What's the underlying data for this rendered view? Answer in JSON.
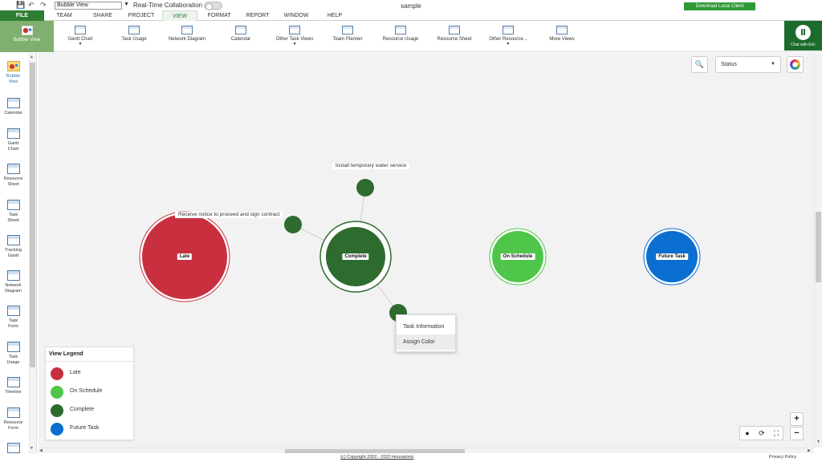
{
  "app": {
    "doc_title": "sample",
    "view_select": "Bubble View",
    "rtc_label": "Real-Time Collaboration",
    "download_label": "Download Local Client",
    "chat_label": "Chat with Eric"
  },
  "menu": [
    "TEAM",
    "SHARE",
    "PROJECT",
    "VIEW",
    "FORMAT",
    "REPORT",
    "WINDOW",
    "HELP"
  ],
  "file_tab": "FILE",
  "active_menu": "VIEW",
  "ribbon": [
    {
      "label": "Bubble View",
      "icon": "bubble-view-icon",
      "dropdown": false,
      "active": true
    },
    {
      "label": "Gantt Chart",
      "icon": "gantt-chart-icon",
      "dropdown": true
    },
    {
      "label": "Task Usage",
      "icon": "task-usage-icon",
      "dropdown": false
    },
    {
      "label": "Network Diagram",
      "icon": "network-diagram-icon",
      "dropdown": false
    },
    {
      "label": "Calendar",
      "icon": "calendar-icon",
      "dropdown": false
    },
    {
      "label": "Other Task Views",
      "icon": "other-task-views-icon",
      "dropdown": true
    },
    {
      "label": "Team Planner",
      "icon": "team-planner-icon",
      "dropdown": false
    },
    {
      "label": "Resource Usage",
      "icon": "resource-usage-icon",
      "dropdown": false
    },
    {
      "label": "Resource Sheet",
      "icon": "resource-sheet-icon",
      "dropdown": false
    },
    {
      "label": "Other Resource...",
      "icon": "other-resource-icon",
      "dropdown": true
    },
    {
      "label": "More Views",
      "icon": "more-views-icon",
      "dropdown": false
    }
  ],
  "sidebar": [
    {
      "line1": "Bubble",
      "line2": "View",
      "active": true
    },
    {
      "line1": "Calendar",
      "line2": ""
    },
    {
      "line1": "Gantt",
      "line2": "Chart"
    },
    {
      "line1": "Resource",
      "line2": "Sheet"
    },
    {
      "line1": "Task",
      "line2": "Sheet"
    },
    {
      "line1": "Tracking",
      "line2": "Gantt"
    },
    {
      "line1": "Network",
      "line2": "Diagram"
    },
    {
      "line1": "Task",
      "line2": "Form"
    },
    {
      "line1": "Task",
      "line2": "Usage"
    },
    {
      "line1": "Timeline",
      "line2": ""
    },
    {
      "line1": "Resource",
      "line2": "Form"
    }
  ],
  "canvas": {
    "status_select": "Status",
    "task_labels": {
      "water": "Install temporary water service",
      "notice": "Receive notice to proceed and sign contract"
    },
    "bubbles": {
      "late": "Late",
      "complete": "Complete",
      "on_schedule": "On Schedule",
      "future": "Future Task"
    },
    "context_menu": [
      "Task Information",
      "Assign Color"
    ],
    "legend": {
      "title": "View Legend",
      "items": [
        {
          "label": "Late",
          "color": "#c9303f"
        },
        {
          "label": "On Schedule",
          "color": "#4fc64a"
        },
        {
          "label": "Complete",
          "color": "#2e6b2e"
        },
        {
          "label": "Future Task",
          "color": "#0b6fd1"
        }
      ]
    }
  },
  "colors": {
    "brand": "#2e7d32",
    "late": "#c9303f",
    "on_schedule": "#4fc64a",
    "complete": "#2e6b2e",
    "future": "#0b6fd1"
  },
  "footer": {
    "copyright": "(c) Copyright 2002 - 2020 Housatonic",
    "privacy": "Privacy Policy"
  }
}
